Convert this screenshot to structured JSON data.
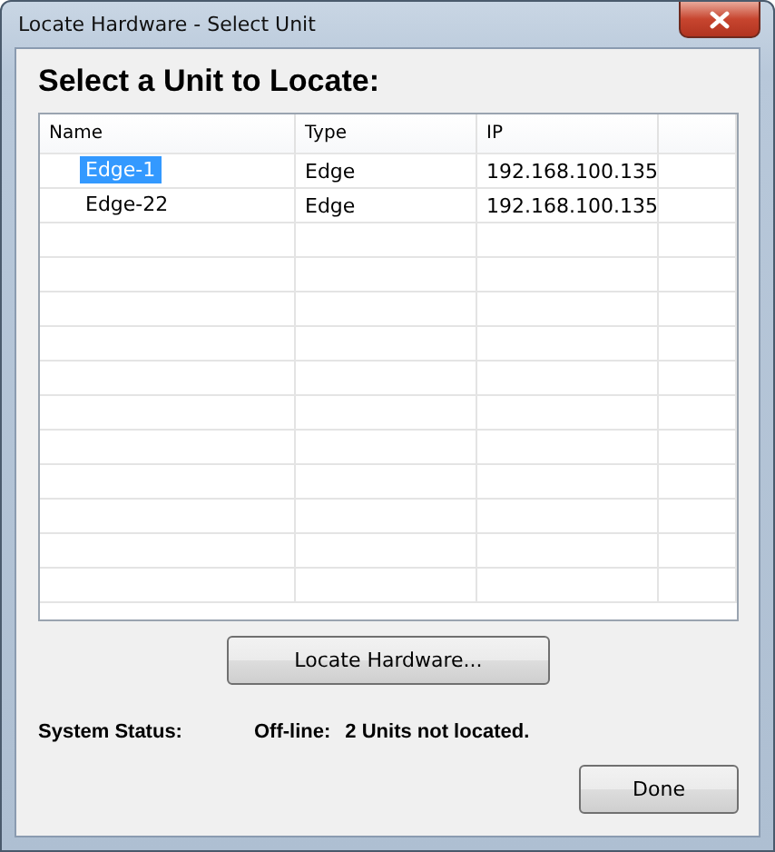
{
  "window": {
    "title": "Locate Hardware - Select Unit"
  },
  "heading": "Select a Unit to Locate:",
  "table": {
    "columns": [
      "Name",
      "Type",
      "IP"
    ],
    "rows": [
      {
        "name": "Edge-1",
        "type": "Edge",
        "ip": "192.168.100.135",
        "selected": true
      },
      {
        "name": "Edge-22",
        "type": "Edge",
        "ip": "192.168.100.135",
        "selected": false
      }
    ]
  },
  "locate_button": "Locate Hardware...",
  "status": {
    "label": "System Status:",
    "state": "Off-line:",
    "message": "2 Units not located."
  },
  "done_button": "Done"
}
